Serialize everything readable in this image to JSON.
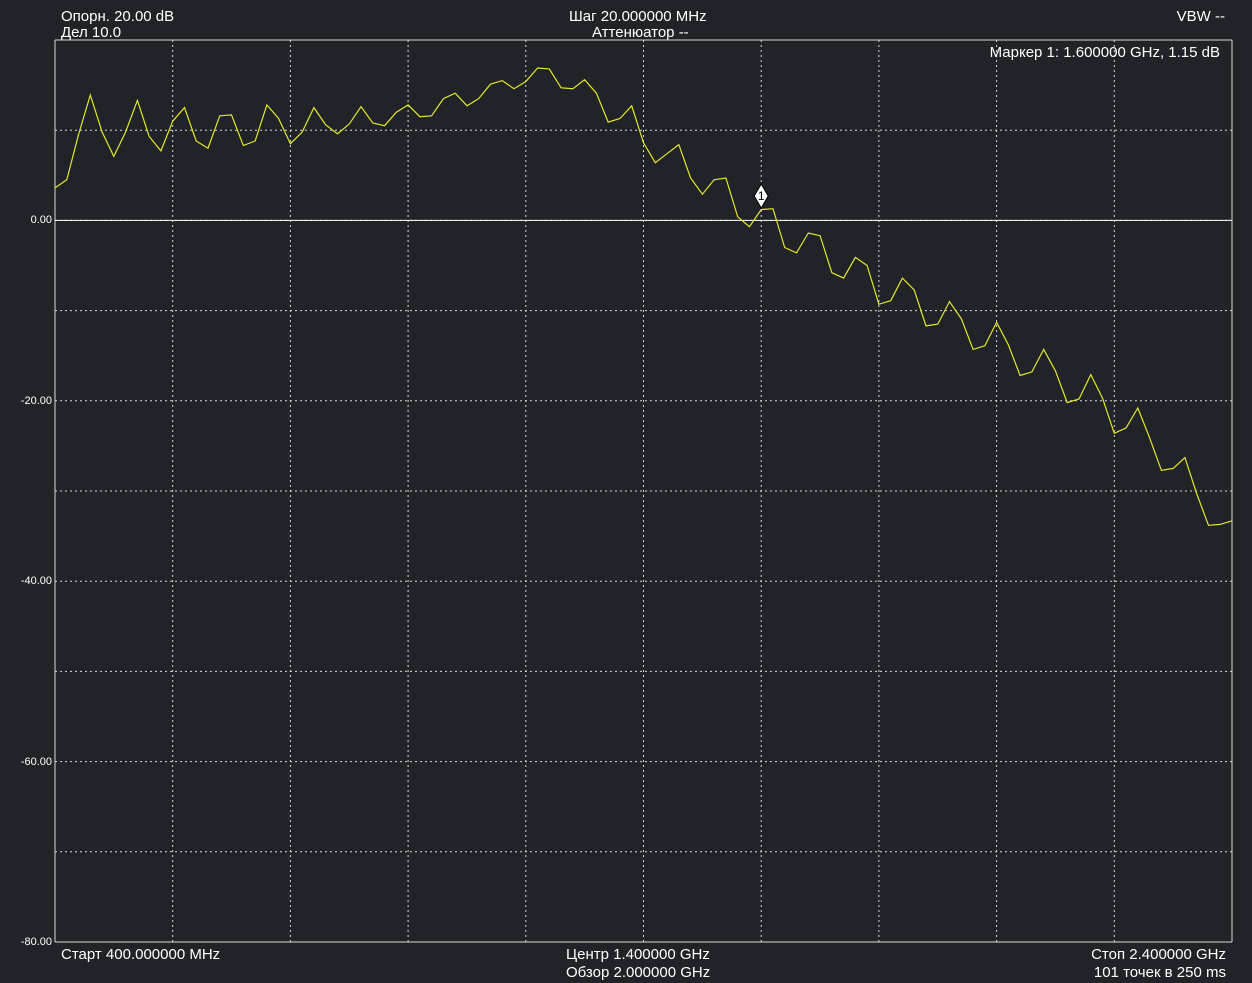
{
  "header": {
    "ref_level": "Опорн. 20.00 dB",
    "scale_div": "Дел 10.0",
    "step": "Шаг 20.000000 MHz",
    "attenuator": "Аттенюатор --",
    "vbw": "VBW --"
  },
  "marker": {
    "readout": "Маркер 1: 1.600000 GHz, 1.15 dB",
    "label": "1",
    "freq_ghz": 1.6,
    "value_db": 1.15
  },
  "footer": {
    "start": "Старт 400.000000 MHz",
    "center": "Центр 1.400000 GHz",
    "span": "Обзор 2.000000 GHz",
    "stop": "Стоп 2.400000 GHz",
    "points": "101 точек в 250 ms"
  },
  "colors": {
    "background": "#202428",
    "grid": "#d8d8d8",
    "trace": "#e6e62a",
    "reference_line": "#ffffff"
  },
  "chart_data": {
    "type": "line",
    "title": "",
    "xlabel": "",
    "ylabel": "",
    "x_unit": "GHz",
    "y_unit": "dB",
    "xlim": [
      0.4,
      2.4
    ],
    "ylim": [
      -80,
      20
    ],
    "grid": true,
    "reference_value": 0,
    "y_tick_labels": [
      "0.00",
      "-20.00",
      "-40.00",
      "-60.00",
      "-80.00"
    ],
    "x_start_ghz": 0.4,
    "x_step_ghz": 0.02,
    "series": [
      {
        "values": [
          3.6,
          4.5,
          9.5,
          13.9,
          9.8,
          7.1,
          9.8,
          13.3,
          9.3,
          7.7,
          11.0,
          12.5,
          8.8,
          8.0,
          11.6,
          11.7,
          8.3,
          8.8,
          12.8,
          11.3,
          8.5,
          9.8,
          12.5,
          10.6,
          9.6,
          10.7,
          12.6,
          10.8,
          10.5,
          12.0,
          12.8,
          11.5,
          11.6,
          13.5,
          14.1,
          12.7,
          13.5,
          15.1,
          15.5,
          14.6,
          15.4,
          16.9,
          16.8,
          14.7,
          14.6,
          15.6,
          14.1,
          10.9,
          11.3,
          12.7,
          8.6,
          6.4,
          7.4,
          8.4,
          4.7,
          2.9,
          4.5,
          4.7,
          0.4,
          -0.7,
          1.2,
          1.3,
          -3.0,
          -3.6,
          -1.4,
          -1.7,
          -5.8,
          -6.4,
          -4.1,
          -5.0,
          -9.3,
          -8.9,
          -6.4,
          -7.7,
          -11.7,
          -11.5,
          -9.0,
          -10.9,
          -14.3,
          -13.9,
          -11.3,
          -13.8,
          -17.2,
          -16.8,
          -14.3,
          -16.7,
          -20.2,
          -19.8,
          -17.1,
          -19.7,
          -23.6,
          -23.0,
          -20.8,
          -24.1,
          -27.7,
          -27.5,
          -26.3,
          -30.3,
          -33.8,
          -33.7,
          -33.3
        ]
      }
    ]
  }
}
